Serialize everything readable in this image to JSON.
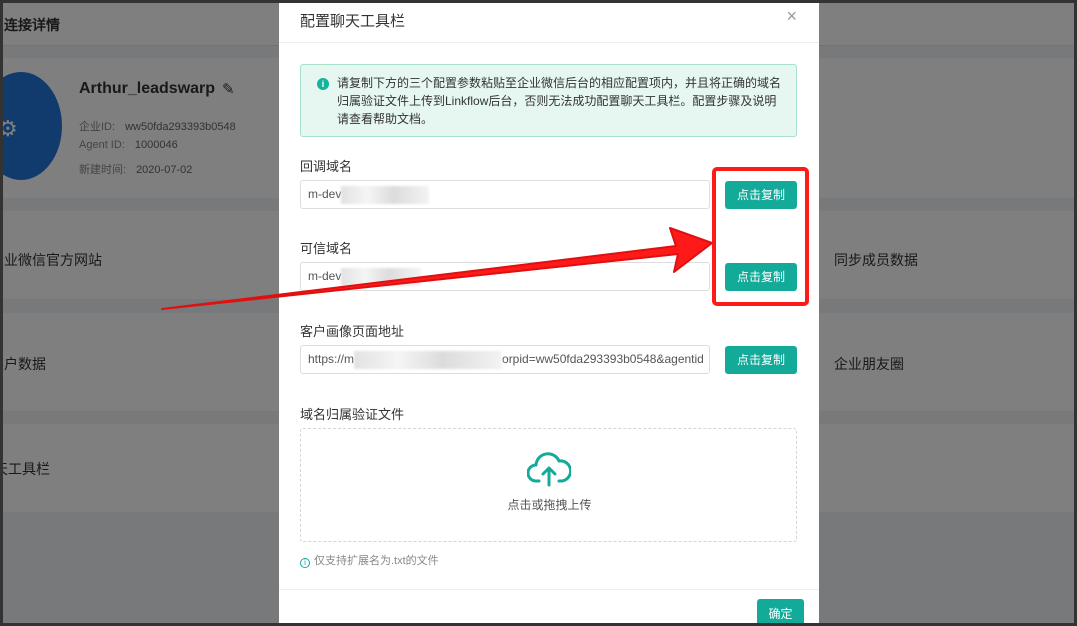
{
  "background": {
    "header_title": "连接详情",
    "profile": {
      "name": "Arthur_leadswarp",
      "corp_id_label": "企业ID:",
      "corp_id_value": "ww50fda293393b0548",
      "agent_id_label": "Agent ID:",
      "agent_id_value": "1000046",
      "created_label": "新建时间:",
      "created_value": "2020-07-02"
    },
    "rows": [
      {
        "left": "企业微信官方网站",
        "right": "同步成员数据"
      },
      {
        "left": "客户数据",
        "right": "企业朋友圈"
      },
      {
        "left": "聊天工具栏",
        "right": ""
      }
    ]
  },
  "modal": {
    "title": "配置聊天工具栏",
    "close_glyph": "×",
    "alert_text": "请复制下方的三个配置参数粘贴至企业微信后台的相应配置项内，并且将正确的域名归属验证文件上传到Linkflow后台，否则无法成功配置聊天工具栏。配置步骤及说明请查看帮助文档。",
    "fields": [
      {
        "label": "回调域名",
        "value_prefix": "m-dev",
        "value_suffix": "",
        "button": "点击复制"
      },
      {
        "label": "可信域名",
        "value_prefix": "m-dev",
        "value_suffix": "",
        "button": "点击复制"
      },
      {
        "label": "客户画像页面地址",
        "value_prefix": "https://m",
        "value_suffix": "orpid=ww50fda293393b0548&agentid",
        "button": "点击复制"
      }
    ],
    "upload": {
      "label": "域名归属验证文件",
      "text": "点击或拖拽上传",
      "icon": "cloud-upload-icon"
    },
    "hint": "仅支持扩展名为.txt的文件",
    "ok_button": "确定"
  },
  "colors": {
    "accent": "#14aa99",
    "annotation": "#ff1a1a"
  }
}
